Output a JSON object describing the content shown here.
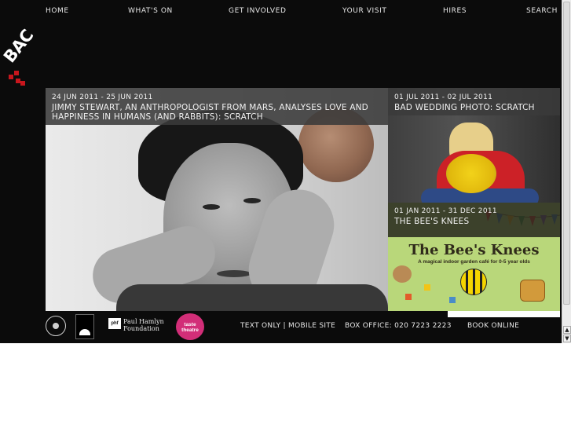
{
  "nav": {
    "items": [
      {
        "label": "HOME"
      },
      {
        "label": "WHAT'S ON"
      },
      {
        "label": "GET INVOLVED"
      },
      {
        "label": "YOUR VISIT"
      },
      {
        "label": "HIRES"
      },
      {
        "label": "SEARCH"
      }
    ]
  },
  "logo": {
    "text": "BAC",
    "icon": "bac-logo",
    "color": "#c8161d"
  },
  "events": [
    {
      "date": "24 JUN 2011 - 25 JUN 2011",
      "title_line1": "JIMMY STEWART, AN ANTHROPOLOGIST FROM MARS, ANALYSES LOVE AND",
      "title_line2": "HAPPINESS IN HUMANS (AND RABBITS): SCRATCH"
    },
    {
      "date": "01 JUL 2011 - 02 JUL 2011",
      "title": "BAD WEDDING PHOTO: SCRATCH"
    },
    {
      "date": "01 JAN 2011 - 31 DEC 2011",
      "title": "THE BEE'S KNEES",
      "poster_title": "The Bee's Knees",
      "poster_subtitle": "A magical indoor garden café for 0-5 year olds"
    }
  ],
  "footer": {
    "text_only_link": "TEXT ONLY | MOBILE SITE",
    "box_office": "BOX OFFICE: 020 7223 2223",
    "book_online": "BOOK ONLINE",
    "phf_abbr": "phf",
    "phf_line1": "Paul Hamlyn",
    "phf_line2": "Foundation",
    "taste_line1": "taste",
    "taste_line2": "theatre"
  },
  "scrollbar": {
    "up_glyph": "▲",
    "down_glyph": "▼"
  }
}
